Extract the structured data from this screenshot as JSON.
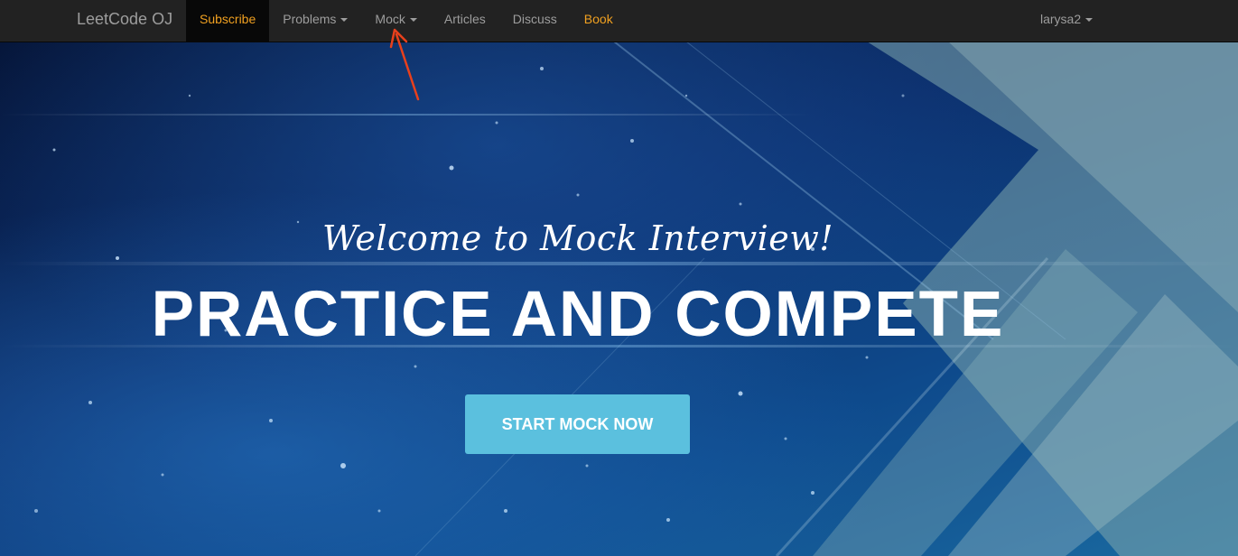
{
  "navbar": {
    "brand": "LeetCode OJ",
    "items": [
      {
        "label": "Subscribe",
        "active": true,
        "highlight": true,
        "dropdown": false
      },
      {
        "label": "Problems",
        "active": false,
        "highlight": false,
        "dropdown": true
      },
      {
        "label": "Mock",
        "active": false,
        "highlight": false,
        "dropdown": true
      },
      {
        "label": "Articles",
        "active": false,
        "highlight": false,
        "dropdown": false
      },
      {
        "label": "Discuss",
        "active": false,
        "highlight": false,
        "dropdown": false
      },
      {
        "label": "Book",
        "active": false,
        "highlight": true,
        "dropdown": false
      }
    ],
    "user": "larysa2"
  },
  "hero": {
    "welcome": "Welcome to Mock Interview!",
    "headline": "PRACTICE AND COMPETE",
    "cta_label": "START MOCK NOW"
  },
  "colors": {
    "navbar_bg": "#222222",
    "nav_text": "#9d9d9d",
    "highlight": "#f0a020",
    "cta_bg": "#5bc0de",
    "annotation_arrow": "#e8401c"
  },
  "icons": {
    "dropdown": "caret-down-icon",
    "annotation": "red-arrow-icon"
  }
}
